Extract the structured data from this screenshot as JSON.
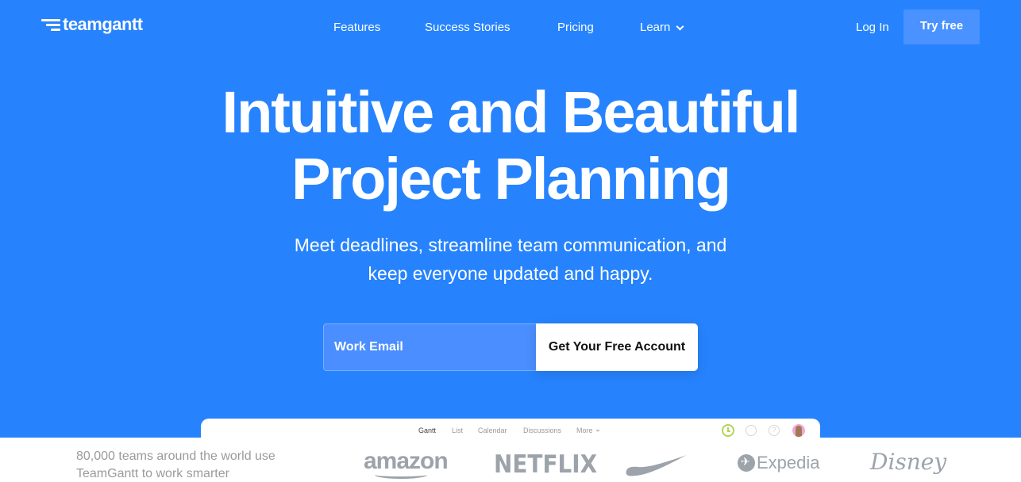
{
  "header": {
    "logo_text": "teamgantt",
    "nav": [
      {
        "label": "Features"
      },
      {
        "label": "Success Stories"
      },
      {
        "label": "Pricing"
      },
      {
        "label": "Learn",
        "has_dropdown": true
      }
    ],
    "login_label": "Log In",
    "try_free_label": "Try free"
  },
  "hero": {
    "headline_line1": "Intuitive and Beautiful",
    "headline_line2": "Project Planning",
    "subhead_line1": "Meet deadlines, streamline team communication, and",
    "subhead_line2": "keep everyone updated and happy.",
    "email_placeholder": "Work Email",
    "email_value": "",
    "cta_label": "Get Your Free Account"
  },
  "preview": {
    "tabs": [
      {
        "label": "Gantt",
        "active": true
      },
      {
        "label": "List",
        "active": false
      },
      {
        "label": "Calendar",
        "active": false
      },
      {
        "label": "Discussions",
        "active": false
      },
      {
        "label": "More",
        "active": false,
        "has_dropdown": true
      }
    ],
    "icons": [
      "clock-icon",
      "search-icon",
      "help-icon",
      "user-avatar"
    ],
    "help_glyph": "?"
  },
  "footer": {
    "trust_line1": "80,000 teams around the world use",
    "trust_line2": "TeamGantt to work smarter",
    "brands": [
      {
        "name": "amazon"
      },
      {
        "name": "NETFLIX"
      },
      {
        "name": "Nike"
      },
      {
        "name": "Expedia"
      },
      {
        "name": "Disney"
      }
    ]
  },
  "colors": {
    "brand_blue": "#2683fd",
    "button_blue": "#4a92ff",
    "input_blue": "#4a8eff",
    "logo_gray": "#9da3aa",
    "clock_green": "#b4d455"
  }
}
